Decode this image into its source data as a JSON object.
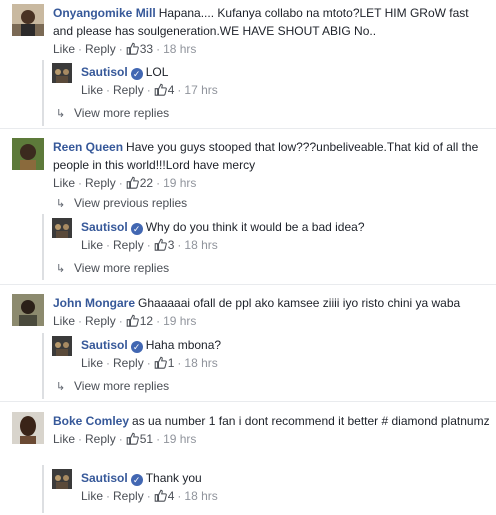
{
  "threads": [
    {
      "comment": {
        "author": "Onyangomike Mill",
        "text": "Hapana.... Kufanya collabo na mtoto?LET HIM GRoW fast and please has soulgeneration.WE HAVE SHOUT ABIG No..",
        "like_label": "Like",
        "reply_label": "Reply",
        "like_count": "33",
        "time": "18 hrs"
      },
      "reply": {
        "author": "Sautisol",
        "text": "LOL",
        "like_label": "Like",
        "reply_label": "Reply",
        "like_count": "4",
        "time": "17 hrs"
      },
      "more_label": "View more replies"
    },
    {
      "comment": {
        "author": "Reen Queen",
        "text": "Have you guys stooped that low???unbeliveable.That kid of all the people in this world!!!Lord have mercy",
        "like_label": "Like",
        "reply_label": "Reply",
        "like_count": "22",
        "time": "19 hrs"
      },
      "previous_label": "View previous replies",
      "reply": {
        "author": "Sautisol",
        "text": "Why do you think it would be a bad idea?",
        "like_label": "Like",
        "reply_label": "Reply",
        "like_count": "3",
        "time": "18 hrs"
      },
      "more_label": "View more replies"
    },
    {
      "comment": {
        "author": "John Mongare",
        "text": "Ghaaaaai ofall de ppl ako kamsee ziiii iyo risto chini ya waba",
        "like_label": "Like",
        "reply_label": "Reply",
        "like_count": "12",
        "time": "19 hrs"
      },
      "reply": {
        "author": "Sautisol",
        "text": "Haha mbona?",
        "like_label": "Like",
        "reply_label": "Reply",
        "like_count": "1",
        "time": "18 hrs"
      },
      "more_label": "View more replies"
    },
    {
      "comment": {
        "author": "Boke Comley",
        "text": "as ua number 1 fan i dont recommend it better # diamond platnumz",
        "like_label": "Like",
        "reply_label": "Reply",
        "like_count": "51",
        "time": "19 hrs"
      },
      "reply": {
        "author": "Sautisol",
        "text": "Thank you",
        "like_label": "Like",
        "reply_label": "Reply",
        "like_count": "4",
        "time": "18 hrs"
      }
    }
  ],
  "colors": {
    "author": "#365899",
    "verified": "#4267b2",
    "meta": "#90949c"
  },
  "icons": {
    "verified": "verified-badge-icon",
    "like": "thumbs-up-icon",
    "reply_arrow": "reply-arrow-icon"
  }
}
